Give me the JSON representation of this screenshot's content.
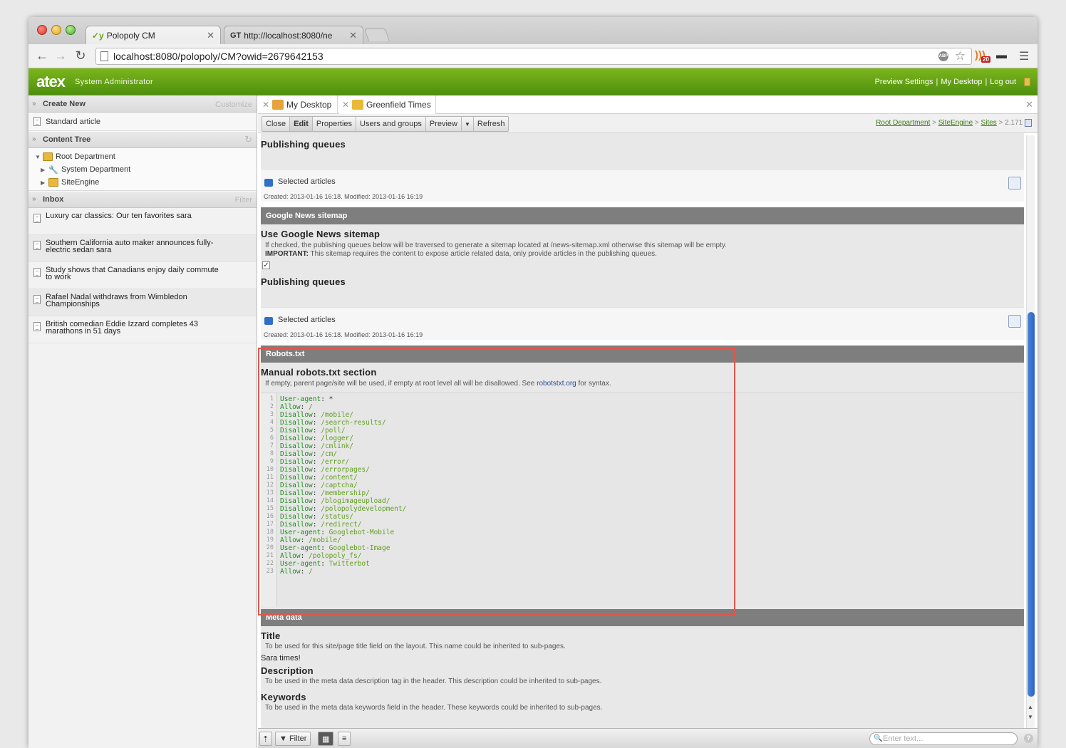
{
  "browser": {
    "tabs": [
      {
        "favicon": "polopoly-icon",
        "title": "Polopoly CM"
      },
      {
        "favicon": "gt-icon",
        "title": "http://localhost:8080/ne"
      }
    ],
    "address": "localhost:8080/polopoly/CM?owid=2679642153",
    "rss_badge": "20"
  },
  "app": {
    "logo": "atex",
    "role": "System Administrator",
    "links": [
      "Preview Settings",
      "My Desktop",
      "Log out"
    ]
  },
  "sidebar": {
    "create_new": {
      "label": "Create New",
      "action": "Customize",
      "items": [
        "Standard article"
      ]
    },
    "content_tree": {
      "label": "Content Tree",
      "nodes": [
        {
          "label": "Root Department",
          "expanded": true
        },
        {
          "label": "System Department"
        },
        {
          "label": "SiteEngine"
        }
      ]
    },
    "inbox": {
      "label": "Inbox",
      "action": "Filter",
      "items": [
        {
          "line1": "Luxury car classics: Our ten favorites sara",
          "line2": ""
        },
        {
          "line1": "Southern California auto maker announces fully-",
          "line2": "electric sedan sara"
        },
        {
          "line1": "Study shows that Canadians enjoy daily commute",
          "line2": "to work"
        },
        {
          "line1": "Rafael Nadal withdraws from Wimbledon",
          "line2": "Championships"
        },
        {
          "line1": "British comedian Eddie Izzard completes 43",
          "line2": "marathons in 51 days"
        }
      ]
    }
  },
  "main": {
    "tabs": [
      "My Desktop",
      "Greenfield Times"
    ],
    "buttons": [
      "Close",
      "Edit",
      "Properties",
      "Users and groups",
      "Preview",
      "Refresh"
    ],
    "breadcrumb": {
      "links": [
        "Root Department",
        "SiteEngine",
        "Sites"
      ],
      "current": "2.171"
    }
  },
  "content": {
    "pq1": {
      "title": "Publishing queues",
      "selected": "Selected articles",
      "meta": "Created: 2013-01-16 16:18. Modified: 2013-01-16 16:19"
    },
    "gnews": {
      "bar": "Google News sitemap",
      "title": "Use Google News sitemap",
      "desc1": "If checked, the publishing queues below will be traversed to generate a sitemap located at /news-sitemap.xml otherwise this sitemap will be empty.",
      "desc2_bold": "IMPORTANT:",
      "desc2": " This sitemap requires the content to expose article related data, only provide articles in the publishing queues.",
      "checked": true,
      "pq_title": "Publishing queues",
      "selected": "Selected articles",
      "meta": "Created: 2013-01-16 16:18. Modified: 2013-01-16 16:19"
    },
    "robots": {
      "bar": "Robots.txt",
      "title": "Manual robots.txt section",
      "desc_pre": "If empty, parent page/site will be used, if empty at root level all will be disallowed. See ",
      "desc_link": "robotstxt.org",
      "desc_post": " for syntax.",
      "lines": [
        [
          "User-agent",
          "*"
        ],
        [
          "Allow",
          "/"
        ],
        [
          "Disallow",
          "/mobile/"
        ],
        [
          "Disallow",
          "/search-results/"
        ],
        [
          "Disallow",
          "/poll/"
        ],
        [
          "Disallow",
          "/logger/"
        ],
        [
          "Disallow",
          "/cmlink/"
        ],
        [
          "Disallow",
          "/cm/"
        ],
        [
          "Disallow",
          "/error/"
        ],
        [
          "Disallow",
          "/errorpages/"
        ],
        [
          "Disallow",
          "/content/"
        ],
        [
          "Disallow",
          "/captcha/"
        ],
        [
          "Disallow",
          "/membership/"
        ],
        [
          "Disallow",
          "/blogimageupload/"
        ],
        [
          "Disallow",
          "/polopolydevelopment/"
        ],
        [
          "Disallow",
          "/status/"
        ],
        [
          "Disallow",
          "/redirect/"
        ],
        [
          "User-agent",
          "Googlebot-Mobile"
        ],
        [
          "Allow",
          "/mobile/"
        ],
        [
          "User-agent",
          "Googlebot-Image"
        ],
        [
          "Allow",
          "/polopoly_fs/"
        ],
        [
          "User-agent",
          "Twitterbot"
        ],
        [
          "Allow",
          "/"
        ]
      ]
    },
    "meta": {
      "bar": "Meta data",
      "title_label": "Title",
      "title_desc": "To be used for this site/page title field on the layout. This name could be inherited to sub-pages.",
      "title_value": "Sara times!",
      "desc_label": "Description",
      "desc_desc": "To be used in the meta data description tag in the header. This description could be inherited to sub-pages.",
      "kw_label": "Keywords",
      "kw_desc": "To be used in the meta data keywords field in the header. These keywords could be inherited to sub-pages."
    }
  },
  "footer": {
    "filter": "Filter",
    "search_placeholder": "Enter text..."
  }
}
